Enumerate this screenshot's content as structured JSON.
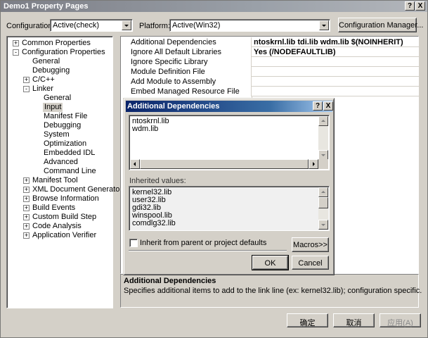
{
  "window": {
    "title": "Demo1 Property Pages",
    "help_glyph": "?",
    "close_glyph": "X"
  },
  "toolbar": {
    "configuration_label": "Configuration:",
    "configuration_value": "Active(check)",
    "platform_label": "Platform:",
    "platform_value": "Active(Win32)",
    "config_manager_label": "Configuration Manager..."
  },
  "tree": {
    "common_properties": "Common Properties",
    "configuration_properties": "Configuration Properties",
    "general": "General",
    "debugging": "Debugging",
    "cpp": "C/C++",
    "linker": "Linker",
    "linker_children": [
      "General",
      "Input",
      "Manifest File",
      "Debugging",
      "System",
      "Optimization",
      "Embedded IDL",
      "Advanced",
      "Command Line"
    ],
    "after_linker": [
      "Manifest Tool",
      "XML Document Generator",
      "Browse Information",
      "Build Events",
      "Custom Build Step",
      "Code Analysis",
      "Application Verifier"
    ],
    "expand_glyph": "+",
    "collapse_glyph": "-"
  },
  "grid": {
    "rows": [
      {
        "name": "Additional Dependencies",
        "value": "ntoskrnl.lib tdi.lib wdm.lib $(NOINHERIT)"
      },
      {
        "name": "Ignore All Default Libraries",
        "value": "Yes (/NODEFAULTLIB)"
      },
      {
        "name": "Ignore Specific Library",
        "value": ""
      },
      {
        "name": "Module Definition File",
        "value": ""
      },
      {
        "name": "Add Module to Assembly",
        "value": ""
      },
      {
        "name": "Embed Managed Resource File",
        "value": ""
      }
    ]
  },
  "description": {
    "title": "Additional Dependencies",
    "text": "Specifies additional items to add to the link line (ex: kernel32.lib); configuration specific."
  },
  "bottom_buttons": {
    "ok": "确定",
    "cancel": "取消",
    "apply": "应用(A)"
  },
  "dialog": {
    "title": "Additional Dependencies",
    "help_glyph": "?",
    "close_glyph": "X",
    "edit_items": [
      "ntoskrnl.lib",
      "wdm.lib"
    ],
    "inherited_label": "Inherited values:",
    "inherited_items": [
      "kernel32.lib",
      "user32.lib",
      "gdi32.lib",
      "winspool.lib",
      "comdlg32.lib"
    ],
    "inherit_checkbox_label": "Inherit from parent or project defaults",
    "inherit_checked": false,
    "macros_label": "Macros>>",
    "ok_label": "OK",
    "cancel_label": "Cancel"
  }
}
